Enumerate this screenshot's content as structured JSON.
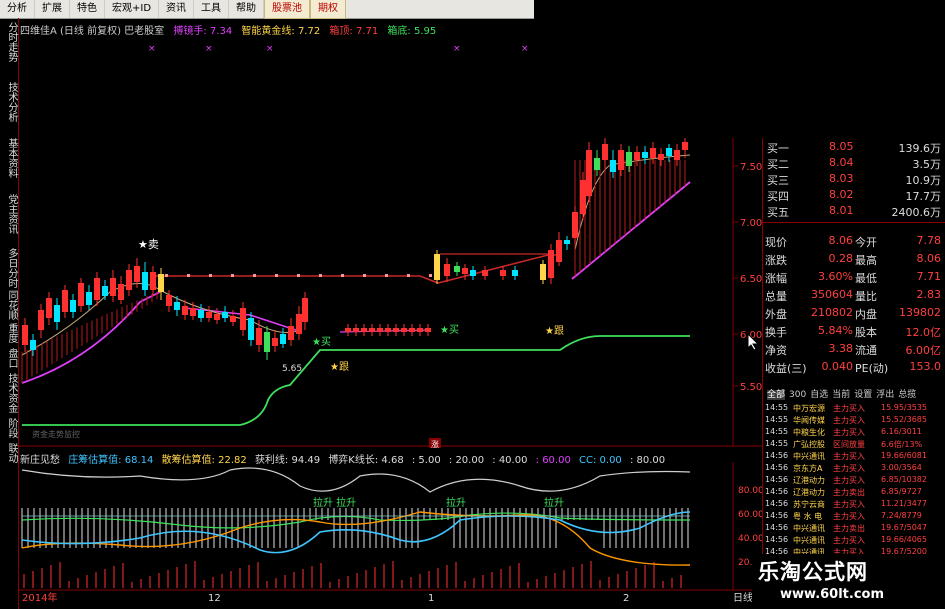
{
  "menu": [
    {
      "label": "分析",
      "highlight": false
    },
    {
      "label": "扩展",
      "highlight": false
    },
    {
      "label": "特色",
      "highlight": false
    },
    {
      "label": "宏观+ID",
      "highlight": false
    },
    {
      "label": "资讯",
      "highlight": false
    },
    {
      "label": "工具",
      "highlight": false
    },
    {
      "label": "帮助",
      "highlight": false
    },
    {
      "label": "股票池",
      "highlight": true
    },
    {
      "label": "期权",
      "highlight": true
    }
  ],
  "side_tabs": [
    "分时走势",
    "技术分析",
    "基本资料",
    "党主资讯",
    "多日分时",
    "同花顺",
    "重度",
    "盘口",
    "技术",
    "资金",
    "阶段",
    "联动"
  ],
  "main_title": {
    "stock": "四维佳A (日线 前复权) 巴老股室",
    "ma1_label": "搏镜手: 7.34",
    "ma2_label": "智能黄金线: 7.72",
    "ma3_label": "箱顶: 7.71",
    "ma4_label": "箱底: 5.95"
  },
  "price_axis": [
    "7.50",
    "7.00",
    "6.50",
    "6.00",
    "5.50"
  ],
  "chart_labels": {
    "sell1": "★卖",
    "buy1": "★买",
    "hold1": "★跟",
    "buy2": "★买",
    "hold2": "★跟",
    "low_price": "5.65",
    "bottom_note": "资金走势监控",
    "zhang": "涨"
  },
  "indicator_title": {
    "name": "新庄见愁",
    "v1": "庄筹估算值: 68.14",
    "v2": "散筹估算值: 22.82",
    "v3": "获利线: 94.49",
    "v4": "博弈K线长: 4.68",
    "v5": ": 5.00",
    "v6": ": 20.00",
    "v7": ": 40.00",
    "v8": ": 60.00",
    "v9": "CC: 0.00",
    "v10": ": 80.00"
  },
  "indicator_axis": [
    "80.00",
    "60.00",
    "40.00",
    "20.00"
  ],
  "indicator_labels": [
    "拉升 拉升",
    "拉升",
    "拉升"
  ],
  "date_axis": [
    "2014年",
    "12",
    "1",
    "2",
    "日线"
  ],
  "quote": {
    "orderbook": [
      {
        "label": "买一",
        "price": "8.05",
        "vol": "139.6万"
      },
      {
        "label": "买二",
        "price": "8.04",
        "vol": "3.5万"
      },
      {
        "label": "买三",
        "price": "8.03",
        "vol": "10.9万"
      },
      {
        "label": "买四",
        "price": "8.02",
        "vol": "17.7万"
      },
      {
        "label": "买五",
        "price": "8.01",
        "vol": "2400.6万"
      }
    ],
    "stats": [
      {
        "l1": "现价",
        "v1": "8.06",
        "l2": "今开",
        "v2": "7.78"
      },
      {
        "l1": "涨跌",
        "v1": "0.28",
        "l2": "最高",
        "v2": "8.06"
      },
      {
        "l1": "涨幅",
        "v1": "3.60%",
        "l2": "最低",
        "v2": "7.71"
      },
      {
        "l1": "总量",
        "v1": "350604",
        "l2": "量比",
        "v2": "2.83"
      },
      {
        "l1": "外盘",
        "v1": "210802",
        "l2": "内盘",
        "v2": "139802"
      },
      {
        "l1": "换手",
        "v1": "5.84%",
        "l2": "股本",
        "v2": "12.0亿"
      },
      {
        "l1": "净资",
        "v1": "3.38",
        "l2": "流通",
        "v2": "6.00亿"
      },
      {
        "l1": "收益(三)",
        "v1": "0.040",
        "l2": "PE(动)",
        "v2": "153.0"
      }
    ]
  },
  "tick_tabs": [
    "全部",
    "300",
    "自选",
    "当前",
    "设置",
    "浮出",
    "总揽"
  ],
  "ticks": [
    {
      "time": "14:55",
      "name": "中万宏源",
      "action": "主力买入",
      "value": "15.95/3535"
    },
    {
      "time": "14:55",
      "name": "华闻传媒",
      "action": "主力买入",
      "value": "15.52/3685"
    },
    {
      "time": "14:55",
      "name": "中粮生化",
      "action": "主力买入",
      "value": "6.16/3011"
    },
    {
      "time": "14:55",
      "name": "广弘控股",
      "action": "区间放量",
      "value": "6.6倍/13%"
    },
    {
      "time": "14:56",
      "name": "中兴通讯",
      "action": "主力买入",
      "value": "19.66/6081"
    },
    {
      "time": "14:56",
      "name": "京东方A",
      "action": "主力买入",
      "value": "3.00/3564"
    },
    {
      "time": "14:56",
      "name": "辽港动力",
      "action": "主力买入",
      "value": "6.85/10382"
    },
    {
      "time": "14:56",
      "name": "辽港动力",
      "action": "主力卖出",
      "value": "6.85/9727"
    },
    {
      "time": "14:56",
      "name": "苏宁云商",
      "action": "主力买入",
      "value": "11.21/3477"
    },
    {
      "time": "14:56",
      "name": "粤 水 电",
      "action": "主力买入",
      "value": "7.24/8779"
    },
    {
      "time": "14:56",
      "name": "中兴通讯",
      "action": "主力卖出",
      "value": "19.67/5047"
    },
    {
      "time": "14:56",
      "name": "中兴通讯",
      "action": "主力买入",
      "value": "19.66/4065"
    },
    {
      "time": "14:56",
      "name": "中兴通讯",
      "action": "主力买入",
      "value": "19.67/5200"
    }
  ],
  "watermark": {
    "cn": "乐淘公式网",
    "url": "www.60lt.com"
  },
  "colors": {
    "up": "#ff3030",
    "down": "#00e5ff",
    "green_line": "#3ee05b",
    "magenta": "#e040fb",
    "yellow": "#ffd54a",
    "border": "#800000"
  }
}
